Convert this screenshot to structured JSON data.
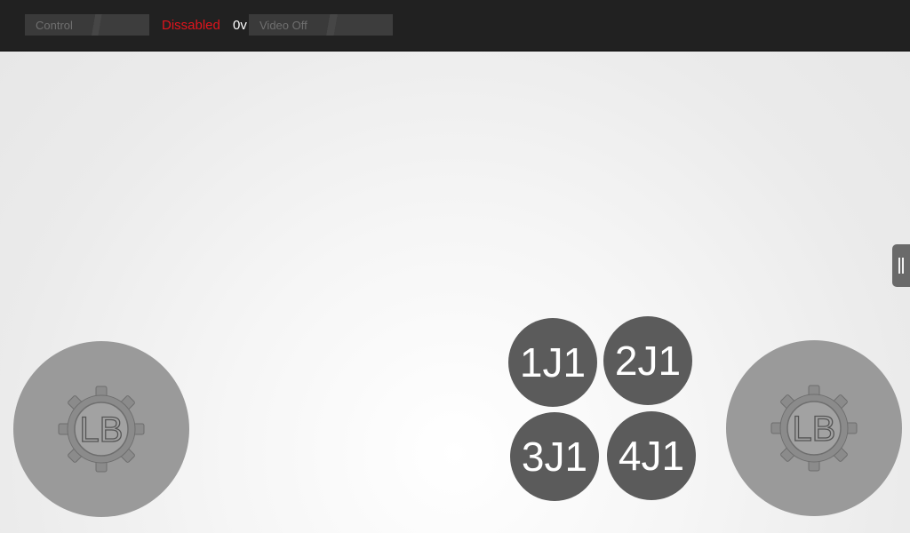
{
  "topbar": {
    "control_label": "Control",
    "status_label": "Dissabled",
    "voltage_label": "0v",
    "video_label": "Video Off"
  },
  "joysticks": {
    "left_logo_text": "LB",
    "right_logo_text": "LB"
  },
  "buttons": [
    {
      "label": "1J1"
    },
    {
      "label": "2J1"
    },
    {
      "label": "3J1"
    },
    {
      "label": "4J1"
    }
  ],
  "colors": {
    "topbar_bg": "#212121",
    "status_disabled": "#e0141c",
    "button_bg": "#5b5b5b",
    "joystick_bg": "#9a9a9a"
  }
}
